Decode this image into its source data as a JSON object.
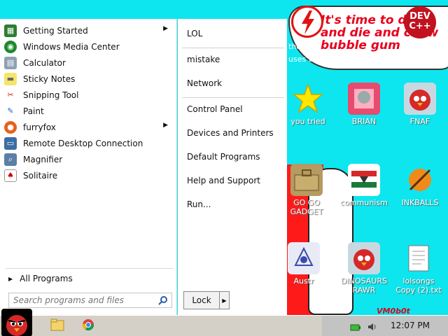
{
  "desktop": {
    "speech_text": "It's time to die and die and chew bubble gum",
    "partial_text_1": "tho",
    "partial_text_2": "uses th",
    "devcpp_label": "DEV C++",
    "watermark": "VM0b0t",
    "icons": [
      {
        "label": "you tried",
        "icon": "star-icon"
      },
      {
        "label": "BRIAN",
        "icon": "brian-icon"
      },
      {
        "label": "FNAF",
        "icon": "angry-bird-icon"
      },
      {
        "label": "GO GO GADGET",
        "icon": "toolbox-icon"
      },
      {
        "label": "communism",
        "icon": "flag-icon"
      },
      {
        "label": "INKBALLS",
        "icon": "inkball-icon"
      },
      {
        "label": "Austr",
        "icon": "austr-icon"
      },
      {
        "label": "DINOSAURS RAWR",
        "icon": "angry-bird-icon"
      },
      {
        "label": "lolsongs Copy (2).txt",
        "icon": "text-file-icon"
      }
    ]
  },
  "start_menu": {
    "programs": [
      {
        "label": "Getting Started",
        "icon": "getting-started-icon",
        "has_submenu": true
      },
      {
        "label": "Windows Media Center",
        "icon": "media-center-icon",
        "has_submenu": false
      },
      {
        "label": "Calculator",
        "icon": "calculator-icon",
        "has_submenu": false
      },
      {
        "label": "Sticky Notes",
        "icon": "sticky-notes-icon",
        "has_submenu": false
      },
      {
        "label": "Snipping Tool",
        "icon": "snipping-tool-icon",
        "has_submenu": false
      },
      {
        "label": "Paint",
        "icon": "paint-icon",
        "has_submenu": false
      },
      {
        "label": "furryfox",
        "icon": "firefox-icon",
        "has_submenu": true
      },
      {
        "label": "Remote Desktop Connection",
        "icon": "remote-desktop-icon",
        "has_submenu": false
      },
      {
        "label": "Magnifier",
        "icon": "magnifier-icon",
        "has_submenu": false
      },
      {
        "label": "Solitaire",
        "icon": "solitaire-icon",
        "has_submenu": false
      }
    ],
    "all_programs": "All Programs",
    "search_placeholder": "Search programs and files",
    "places": [
      "LOL",
      "mistake",
      "Network",
      "Control Panel",
      "Devices and Printers",
      "Default Programs",
      "Help and Support",
      "Run..."
    ],
    "lock_label": "Lock"
  },
  "taskbar": {
    "clock": "12:07 PM",
    "pinned": [
      "explorer-icon",
      "chrome-icon"
    ]
  },
  "colors": {
    "desktop_bg": "#0de6ee",
    "speech_red": "#e8001c",
    "taskbar": "#d4d0c8"
  }
}
